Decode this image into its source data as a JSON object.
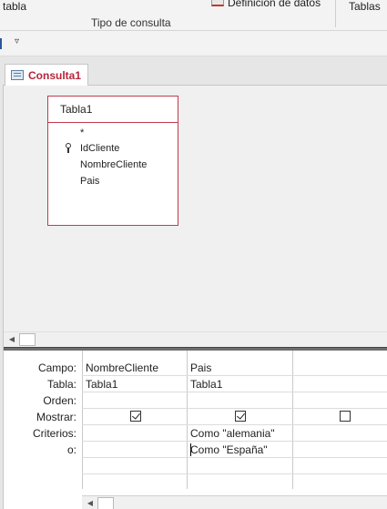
{
  "ribbon": {
    "left_label": "tabla",
    "group_label": "Tipo de consulta",
    "definition_label": "Definición de datos",
    "tables_label": "Tablas"
  },
  "document": {
    "tab_label": "Consulta1"
  },
  "table": {
    "title": "Tabla1",
    "fields": [
      "*",
      "IdCliente",
      "NombreCliente",
      "Pais"
    ],
    "primary_key_field": "IdCliente"
  },
  "grid": {
    "row_labels": [
      "Campo:",
      "Tabla:",
      "Orden:",
      "Mostrar:",
      "Criterios:",
      "o:"
    ],
    "columns": [
      {
        "campo": "NombreCliente",
        "tabla": "Tabla1",
        "orden": "",
        "mostrar": true,
        "criterios": "",
        "o": ""
      },
      {
        "campo": "Pais",
        "tabla": "Tabla1",
        "orden": "",
        "mostrar": true,
        "criterios": "Como \"alemania\"",
        "o": "Como \"España\""
      },
      {
        "campo": "",
        "tabla": "",
        "orden": "",
        "mostrar": false,
        "criterios": "",
        "o": ""
      }
    ]
  },
  "colors": {
    "accent": "#c23b4b",
    "tab_text": "#b5273a"
  }
}
